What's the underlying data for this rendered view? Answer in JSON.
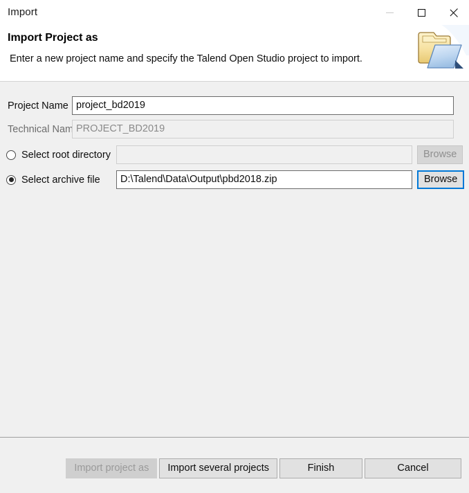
{
  "window": {
    "title": "Import",
    "controls": {
      "minimize": "minimize-button",
      "maximize": "maximize-button",
      "close": "close-button"
    }
  },
  "header": {
    "title": "Import Project as",
    "description": "Enter a new project name and specify the Talend Open Studio project to import.",
    "banner_icon": "import-folder-icon"
  },
  "form": {
    "project_name": {
      "label": "Project Name",
      "value": "project_bd2019"
    },
    "technical_name": {
      "label": "Technical Name",
      "value": "PROJECT_BD2019"
    },
    "root_directory": {
      "label": "Select root directory",
      "selected": false,
      "value": "",
      "browse_label": "Browse",
      "browse_enabled": false
    },
    "archive_file": {
      "label": "Select archive file",
      "selected": true,
      "value": "D:\\Talend\\Data\\Output\\pbd2018.zip",
      "browse_label": "Browse",
      "browse_enabled": true,
      "browse_focused": true
    }
  },
  "footer": {
    "buttons": [
      {
        "label": "Import project as",
        "enabled": false
      },
      {
        "label": "Import several projects",
        "enabled": true
      },
      {
        "label": "Finish",
        "enabled": true
      },
      {
        "label": "Cancel",
        "enabled": true
      }
    ]
  },
  "colors": {
    "focus_blue": "#0078d7",
    "body_background": "#f0f0f0",
    "header_background": "#ffffff",
    "folder_yellow": "#f5dd8e",
    "folder_blue": "#bcd6f0"
  }
}
